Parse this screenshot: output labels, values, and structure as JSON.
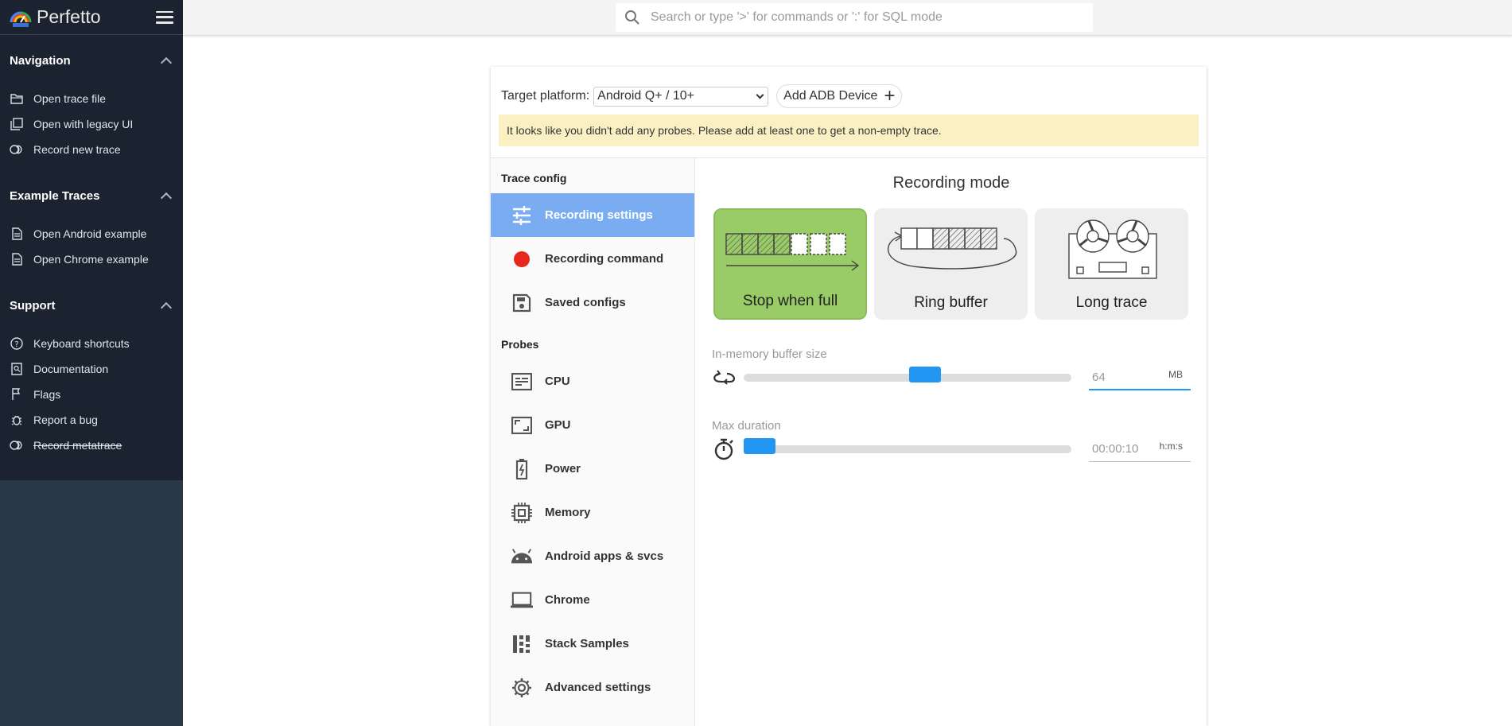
{
  "app": {
    "name": "Perfetto"
  },
  "search": {
    "placeholder": "Search or type '>' for commands or ':' for SQL mode"
  },
  "sidebar": {
    "sections": [
      {
        "title": "Navigation",
        "items": [
          {
            "label": "Open trace file",
            "icon": "folder-icon"
          },
          {
            "label": "Open with legacy UI",
            "icon": "legacy-ui-icon"
          },
          {
            "label": "Record new trace",
            "icon": "record-icon"
          }
        ]
      },
      {
        "title": "Example Traces",
        "items": [
          {
            "label": "Open Android example",
            "icon": "document-icon"
          },
          {
            "label": "Open Chrome example",
            "icon": "document-icon"
          }
        ]
      },
      {
        "title": "Support",
        "items": [
          {
            "label": "Keyboard shortcuts",
            "icon": "help-icon"
          },
          {
            "label": "Documentation",
            "icon": "documentation-icon"
          },
          {
            "label": "Flags",
            "icon": "flag-icon"
          },
          {
            "label": "Report a bug",
            "icon": "bug-icon"
          },
          {
            "label": "Record metatrace",
            "icon": "record-icon"
          }
        ]
      }
    ]
  },
  "record": {
    "platform_label": "Target platform:",
    "platform_value": "Android Q+ / 10+",
    "add_adb_label": "Add ADB Device",
    "add_adb_plus": "+",
    "warning": "It looks like you didn't add any probes. Please add at least one to get a non-empty trace.",
    "trace_config_heading": "Trace config",
    "probes_heading": "Probes",
    "config_items": [
      {
        "label": "Recording settings",
        "icon": "sliders-icon"
      },
      {
        "label": "Recording command",
        "icon": "red-dot-icon"
      },
      {
        "label": "Saved configs",
        "icon": "save-icon"
      }
    ],
    "probe_items": [
      {
        "label": "CPU",
        "icon": "cpu-icon"
      },
      {
        "label": "GPU",
        "icon": "gpu-icon"
      },
      {
        "label": "Power",
        "icon": "battery-icon"
      },
      {
        "label": "Memory",
        "icon": "memory-icon"
      },
      {
        "label": "Android apps & svcs",
        "icon": "android-icon"
      },
      {
        "label": "Chrome",
        "icon": "laptop-icon"
      },
      {
        "label": "Stack Samples",
        "icon": "stack-samples-icon"
      },
      {
        "label": "Advanced settings",
        "icon": "gear-icon"
      }
    ],
    "mode_title": "Recording mode",
    "modes": [
      {
        "label": "Stop when full",
        "selected": true
      },
      {
        "label": "Ring buffer",
        "selected": false
      },
      {
        "label": "Long trace",
        "selected": false
      }
    ],
    "buffer": {
      "label": "In-memory buffer size",
      "value": "64",
      "unit": "MB",
      "fraction": 0.56
    },
    "duration": {
      "label": "Max duration",
      "value": "00:00:10",
      "unit": "h:m:s",
      "fraction": 0.0
    }
  },
  "colors": {
    "sidebar_bg": "#2b3847",
    "active_item": "#7aacf2",
    "warning_bg": "#faf0c3",
    "slider_thumb": "#2196f3",
    "selected_mode": "#99cc66"
  }
}
